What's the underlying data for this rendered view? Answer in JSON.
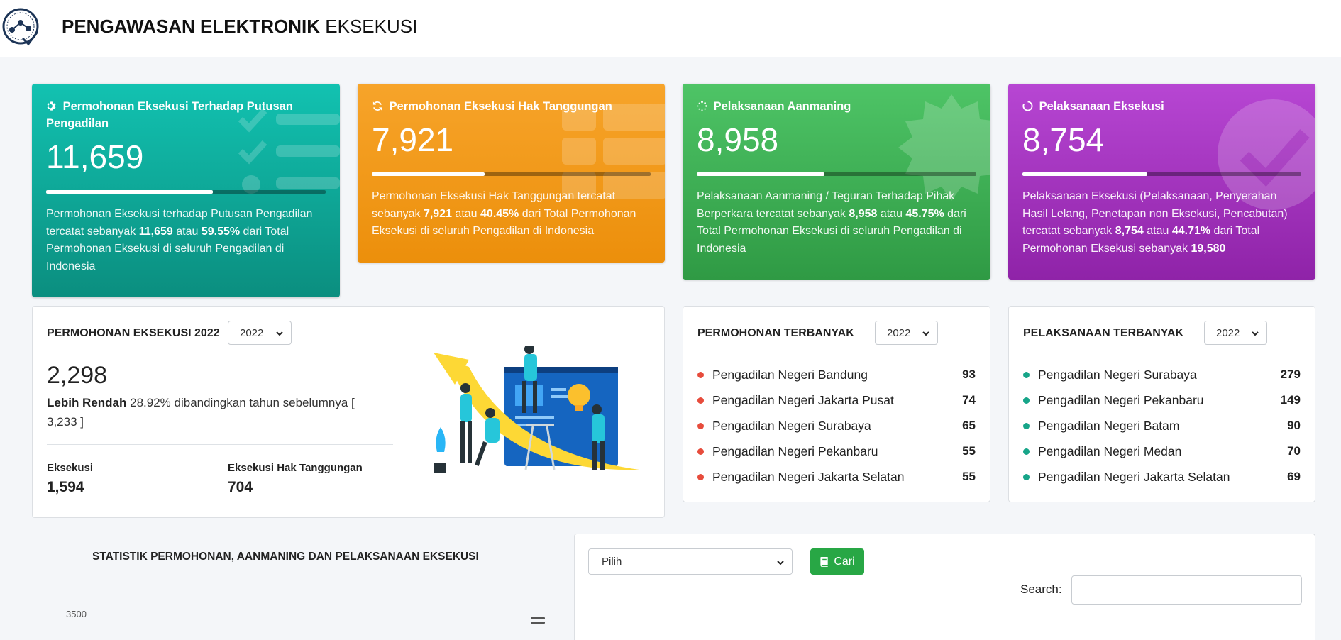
{
  "header": {
    "brand_bold": "PENGAWASAN ELEKTRONIK",
    "brand_light": "EKSEKUSI"
  },
  "cards": [
    {
      "icon": "gear-icon",
      "title": "Permohonan Eksekusi Terhadap Putusan Pengadilan",
      "value": "11,659",
      "progress_percent": 59.55,
      "desc_1": "Permohonan Eksekusi terhadap Putusan Pengadilan tercatat sebanyak ",
      "count": "11,659",
      "desc_2": " atau ",
      "percent": "59.55%",
      "desc_3": " dari Total Permohonan Eksekusi di seluruh Pengadilan di Indonesia",
      "color": "#0fa898"
    },
    {
      "icon": "refresh-icon",
      "title": "Permohonan Eksekusi Hak Tanggungan",
      "value": "7,921",
      "progress_percent": 40.45,
      "desc_1": "Permohonan Eksekusi Hak Tanggungan tercatat sebanyak ",
      "count": "7,921",
      "desc_2": " atau ",
      "percent": "40.45%",
      "desc_3": " dari Total Permohonan Eksekusi di seluruh Pengadilan di Indonesia",
      "color": "#f29a1a"
    },
    {
      "icon": "spinner-icon",
      "title": "Pelaksanaan Aanmaning",
      "value": "8,958",
      "progress_percent": 45.75,
      "desc_1": "Pelaksanaan Aanmaning / Teguran Terhadap Pihak Berperkara tercatat sebanyak ",
      "count": "8,958",
      "desc_2": " atau ",
      "percent": "45.75%",
      "desc_3": " dari Total Permohonan Eksekusi di seluruh Pengadilan di Indonesia",
      "color": "#3cb055"
    },
    {
      "icon": "circle-notch-icon",
      "title": "Pelaksanaan Eksekusi",
      "value": "8,754",
      "progress_percent": 44.71,
      "desc_1": "Pelaksanaan Eksekusi (Pelaksanaan, Penyerahan Hasil Lelang, Penetapan non Eksekusi, Pencabutan) tercatat sebanyak ",
      "count": "8,754",
      "desc_2": " atau ",
      "percent": "44.71%",
      "desc_3": " dari Total Permohonan Eksekusi sebanyak ",
      "total": "19,580",
      "color": "#a433be"
    }
  ],
  "permohonan_panel": {
    "title": "PERMOHONAN EKSEKUSI 2022",
    "year_select": "2022",
    "total": "2,298",
    "compare_bold": "Lebih Rendah",
    "compare_text": " 28.92% dibandingkan tahun sebelumnya [ 3,233 ]",
    "eksekusi_label": "Eksekusi",
    "eksekusi_value": "1,594",
    "ht_label": "Eksekusi Hak Tanggungan",
    "ht_value": "704"
  },
  "permohonan_terbanyak": {
    "title": "PERMOHONAN TERBANYAK",
    "year_select": "2022",
    "dot_color": "#e74c3c",
    "items": [
      {
        "name": "Pengadilan Negeri Bandung",
        "value": "93"
      },
      {
        "name": "Pengadilan Negeri Jakarta Pusat",
        "value": "74"
      },
      {
        "name": "Pengadilan Negeri Surabaya",
        "value": "65"
      },
      {
        "name": "Pengadilan Negeri Pekanbaru",
        "value": "55"
      },
      {
        "name": "Pengadilan Negeri Jakarta Selatan",
        "value": "55"
      }
    ]
  },
  "pelaksanaan_terbanyak": {
    "title": "PELAKSANAAN TERBANYAK",
    "year_select": "2022",
    "dot_color": "#17a589",
    "items": [
      {
        "name": "Pengadilan Negeri Surabaya",
        "value": "279"
      },
      {
        "name": "Pengadilan Negeri Pekanbaru",
        "value": "149"
      },
      {
        "name": "Pengadilan Negeri Batam",
        "value": "90"
      },
      {
        "name": "Pengadilan Negeri Medan",
        "value": "70"
      },
      {
        "name": "Pengadilan Negeri Jakarta Selatan",
        "value": "69"
      }
    ]
  },
  "statistik": {
    "title": "STATISTIK PERMOHONAN, AANMANING DAN PELAKSANAAN EKSEKUSI",
    "ytick_top": "3500",
    "menu_icon": "hamburger-icon"
  },
  "filter": {
    "select_value": "Pilih",
    "button_label": "Cari",
    "button_icon": "book-icon",
    "search_label": "Search:",
    "search_value": ""
  }
}
